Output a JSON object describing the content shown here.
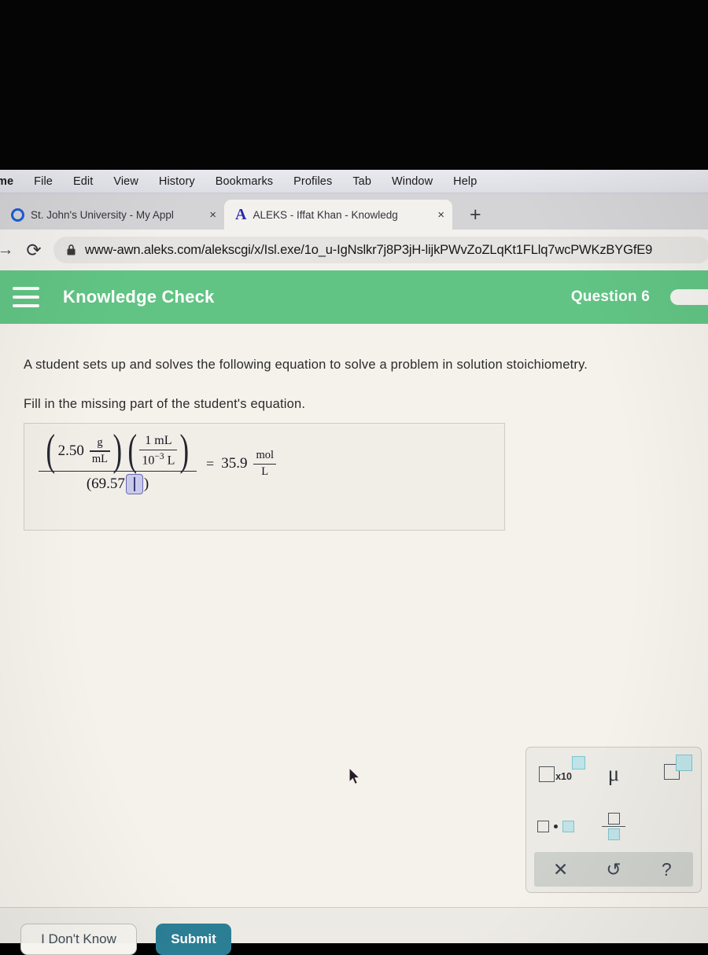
{
  "os_menu": {
    "items": [
      "me",
      "File",
      "Edit",
      "View",
      "History",
      "Bookmarks",
      "Profiles",
      "Tab",
      "Window",
      "Help"
    ]
  },
  "browser": {
    "tabs": [
      {
        "title": "St. John's University - My Appl",
        "favicon": "circle-o-icon",
        "close": "×",
        "active": false
      },
      {
        "title": "ALEKS - Iffat Khan - Knowledg",
        "favicon": "letter-a-icon",
        "close": "×",
        "active": true
      }
    ],
    "new_tab_label": "+",
    "forward_glyph": "→",
    "reload_glyph": "⟳",
    "lock_icon": "lock-icon",
    "url": "www-awn.aleks.com/alekscgi/x/Isl.exe/1o_u-IgNslkr7j8P3jH-lijkPWvZoZLqKt1FLlq7wcPWKzBYGfE9"
  },
  "app_header": {
    "menu_icon": "hamburger-icon",
    "title": "Knowledge Check",
    "question_label": "Question 6",
    "accent_color": "#61c484",
    "progress_color": "#f4f3ef"
  },
  "prompt": {
    "line1": "A student sets up and solves the following equation to solve a problem in solution stoichiometry.",
    "line2": "Fill in the missing part of the student's equation."
  },
  "equation": {
    "factor1": {
      "value": "2.50",
      "unit_num": "g",
      "unit_den": "mL"
    },
    "factor2": {
      "num": "1 mL",
      "den_base": "10",
      "den_exp": "−3",
      "den_unit": "L"
    },
    "denominator_prefix": "(69.57",
    "denominator_blank": "",
    "denominator_suffix": ")",
    "equals": "=",
    "result_value": "35.9",
    "result_unit_num": "mol",
    "result_unit_den": "L"
  },
  "palette": {
    "buttons": [
      {
        "name": "scientific-notation-button",
        "x10_label": "x10"
      },
      {
        "name": "micro-button",
        "label": "μ"
      },
      {
        "name": "superscript-button",
        "label": ""
      },
      {
        "name": "multiply-dot-button",
        "label": ""
      },
      {
        "name": "fraction-button",
        "label": ""
      }
    ],
    "actions": [
      {
        "name": "clear-button",
        "glyph": "✕"
      },
      {
        "name": "undo-button",
        "glyph": "↺"
      },
      {
        "name": "help-button",
        "glyph": "?"
      }
    ]
  },
  "footer": {
    "dont_know_label": "I Don't Know",
    "submit_label": "Submit",
    "submit_color": "#2b7f95"
  }
}
